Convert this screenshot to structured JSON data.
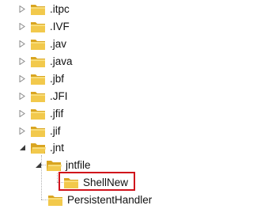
{
  "tree": {
    "items": [
      {
        "label": ".itpc",
        "icon": "folder-icon",
        "expander": "collapsed"
      },
      {
        "label": ".IVF",
        "icon": "folder-icon",
        "expander": "collapsed"
      },
      {
        "label": ".jav",
        "icon": "folder-icon",
        "expander": "collapsed"
      },
      {
        "label": ".java",
        "icon": "folder-icon",
        "expander": "collapsed"
      },
      {
        "label": ".jbf",
        "icon": "folder-icon",
        "expander": "collapsed"
      },
      {
        "label": ".JFI",
        "icon": "folder-icon",
        "expander": "collapsed"
      },
      {
        "label": ".jfif",
        "icon": "folder-icon",
        "expander": "collapsed"
      },
      {
        "label": ".jif",
        "icon": "folder-icon",
        "expander": "collapsed"
      },
      {
        "label": ".jnt",
        "icon": "folder-icon",
        "expander": "expanded"
      },
      {
        "label": "jntfile",
        "icon": "folder-icon",
        "expander": "expanded"
      },
      {
        "label": "ShellNew",
        "icon": "folder-icon",
        "expander": "none",
        "highlighted": true
      },
      {
        "label": "PersistentHandler",
        "icon": "folder-icon",
        "expander": "none"
      }
    ]
  },
  "colors": {
    "highlight_border": "#d0121b",
    "folder_fill": "#f2c94c",
    "folder_dark": "#d9a521"
  }
}
